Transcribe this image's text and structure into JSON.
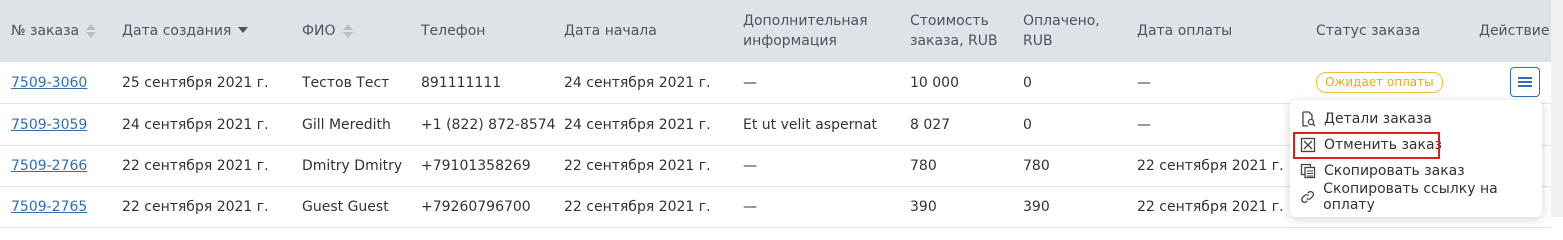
{
  "headers": {
    "order_no": "№ заказа",
    "created": "Дата создания",
    "fio": "ФИО",
    "phone": "Телефон",
    "start": "Дата начала",
    "info_l1": "Дополнительная",
    "info_l2": "информация",
    "cost_l1": "Стоимость",
    "cost_l2": "заказа, RUB",
    "paid_l1": "Оплачено,",
    "paid_l2": "RUB",
    "pay_date": "Дата оплаты",
    "status": "Статус заказа",
    "action": "Действие"
  },
  "rows": [
    {
      "order": "7509-3060",
      "created": "25 сентября 2021 г.",
      "fio": "Тестов Тест",
      "phone": "891111111",
      "start": "24 сентября 2021 г.",
      "info": "—",
      "cost": "10 000",
      "paid": "0",
      "pay_date": "—",
      "status": "Ожидает оплаты"
    },
    {
      "order": "7509-3059",
      "created": "24 сентября 2021 г.",
      "fio": "Gill Meredith",
      "phone": "+1 (822) 872-8574",
      "start": "24 сентября 2021 г.",
      "info": "Et ut velit aspernat",
      "cost": "8 027",
      "paid": "0",
      "pay_date": "—",
      "status": ""
    },
    {
      "order": "7509-2766",
      "created": "22 сентября 2021 г.",
      "fio": "Dmitry Dmitry",
      "phone": "+79101358269",
      "start": "22 сентября 2021 г.",
      "info": "—",
      "cost": "780",
      "paid": "780",
      "pay_date": "22 сентября 2021 г.",
      "status": ""
    },
    {
      "order": "7509-2765",
      "created": "22 сентября 2021 г.",
      "fio": "Guest Guest",
      "phone": "+79260796700",
      "start": "22 сентября 2021 г.",
      "info": "—",
      "cost": "390",
      "paid": "390",
      "pay_date": "22 сентября 2021 г.",
      "status": ""
    }
  ],
  "menu": {
    "details": "Детали заказа",
    "cancel": "Отменить заказ",
    "copy": "Скопировать заказ",
    "copy_link": "Скопировать ссылку на оплату"
  },
  "colors": {
    "header_bg": "#dfe3e8",
    "link": "#2f6fb5",
    "status_pending": "#f5b93a",
    "highlight": "#e02020"
  }
}
